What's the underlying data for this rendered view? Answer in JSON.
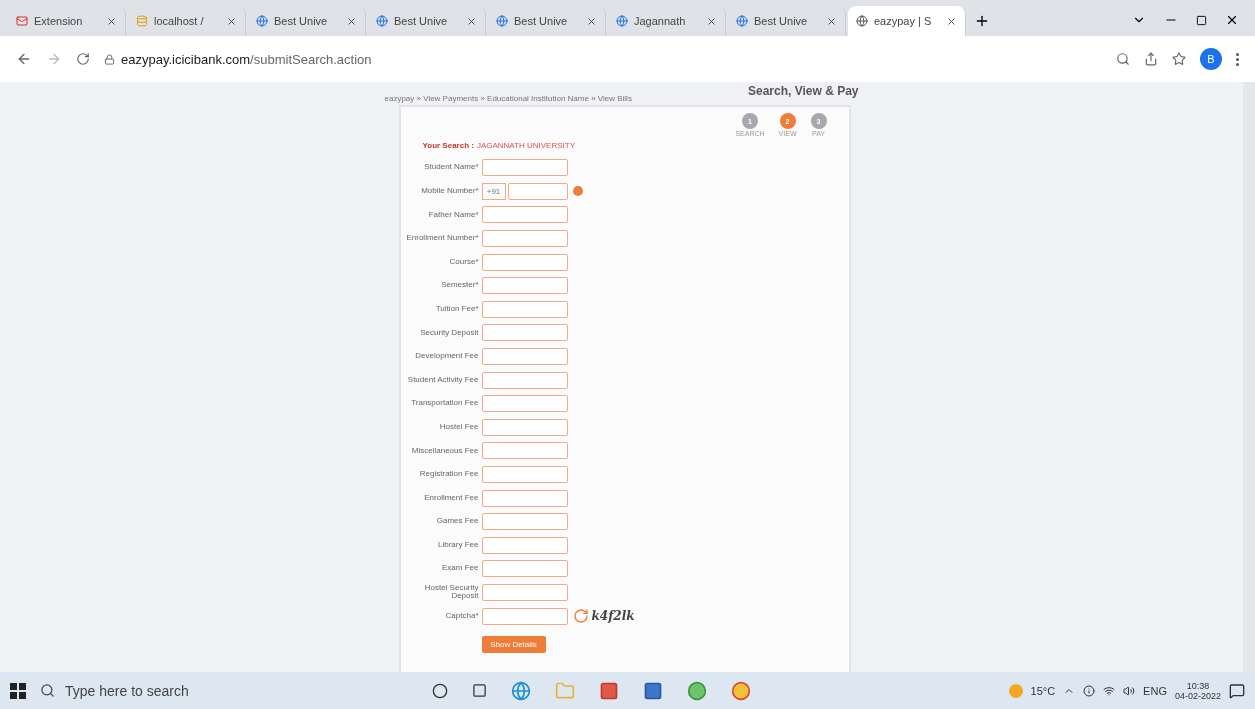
{
  "browser": {
    "tabs": [
      {
        "label": "Extension",
        "selected": false
      },
      {
        "label": "localhost /",
        "selected": false
      },
      {
        "label": "Best Unive",
        "selected": false
      },
      {
        "label": "Best Unive",
        "selected": false
      },
      {
        "label": "Best Unive",
        "selected": false
      },
      {
        "label": "Jagannath",
        "selected": false
      },
      {
        "label": "Best Unive",
        "selected": false
      },
      {
        "label": "eazypay | S",
        "selected": true
      }
    ],
    "url_host": "eazypay.icicibank.com",
    "url_path": "/submitSearch.action",
    "profile": "B"
  },
  "page": {
    "breadcrumb": "eazypay » View Payments » Educational Institution Name » View Bills",
    "heading": "Search, View & Pay",
    "steps": [
      {
        "number": "1",
        "label": "SEARCH",
        "selected": false
      },
      {
        "number": "2",
        "label": "VIEW",
        "selected": true
      },
      {
        "number": "3",
        "label": "PAY",
        "selected": false
      }
    ],
    "search_label": "Your Search :",
    "search_value": "JAGANNATH UNIVERSITY",
    "fields": [
      {
        "label": "Student Name*",
        "kind": "text"
      },
      {
        "label": "Mobile Number*",
        "kind": "phone",
        "prefix": "+91"
      },
      {
        "label": "Father Name*",
        "kind": "text"
      },
      {
        "label": "Enrollment Number*",
        "kind": "text"
      },
      {
        "label": "Course*",
        "kind": "text"
      },
      {
        "label": "Semester*",
        "kind": "text"
      },
      {
        "label": "Tuition Fee*",
        "kind": "text"
      },
      {
        "label": "Security Deposit",
        "kind": "text"
      },
      {
        "label": "Development Fee",
        "kind": "text"
      },
      {
        "label": "Student Activity Fee",
        "kind": "text"
      },
      {
        "label": "Transportation Fee",
        "kind": "text"
      },
      {
        "label": "Hostel Fee",
        "kind": "text"
      },
      {
        "label": "Miscellaneous Fee",
        "kind": "text"
      },
      {
        "label": "Registration Fee",
        "kind": "text"
      },
      {
        "label": "Enrollment Fee",
        "kind": "text"
      },
      {
        "label": "Games Fee",
        "kind": "text"
      },
      {
        "label": "Library Fee",
        "kind": "text"
      },
      {
        "label": "Exam Fee",
        "kind": "text"
      },
      {
        "label": "Hostel Security Deposit",
        "kind": "text"
      },
      {
        "label": "Captcha*",
        "kind": "captcha",
        "captcha": "k4f2lk"
      }
    ],
    "submit": "Show Details"
  },
  "taskbar": {
    "search_placeholder": "Type here to search",
    "weather": "15°C",
    "language": "ENG",
    "time": "10:38",
    "date": "04-02-2022"
  }
}
